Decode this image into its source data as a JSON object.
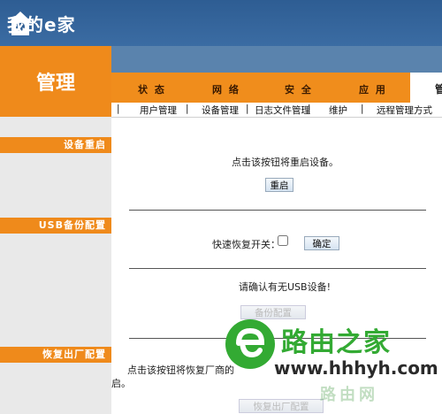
{
  "logo": {
    "text": "我的e家"
  },
  "header": {
    "section_title": "管理"
  },
  "nav": {
    "tabs": [
      "状 态",
      "网 络",
      "安 全",
      "应 用",
      "管"
    ],
    "subtabs": [
      "用户管理",
      "设备管理",
      "日志文件管理",
      "维护",
      "远程管理方式"
    ]
  },
  "sidebar": {
    "items": [
      "设备重启",
      "USB备份配置",
      "恢复出厂配置"
    ]
  },
  "reboot": {
    "hint": "点击该按钮将重启设备。",
    "button": "重启"
  },
  "usb": {
    "quick_restore_label": "快速恢复开关：",
    "confirm_button": "确定",
    "notice": "请确认有无USB设备!",
    "backup_button": "备份配置"
  },
  "factory": {
    "hint_start": "点击该按钮将恢复厂商的",
    "hint_end": "启。",
    "button": "恢复出厂配置"
  },
  "watermark": {
    "brand": "路由之家",
    "url": "www.hhhyh.com",
    "sub": "路由网"
  },
  "colors": {
    "orange": "#ef8a1b",
    "blue": "#2e5d93",
    "watermark_green": "#33aa33"
  }
}
